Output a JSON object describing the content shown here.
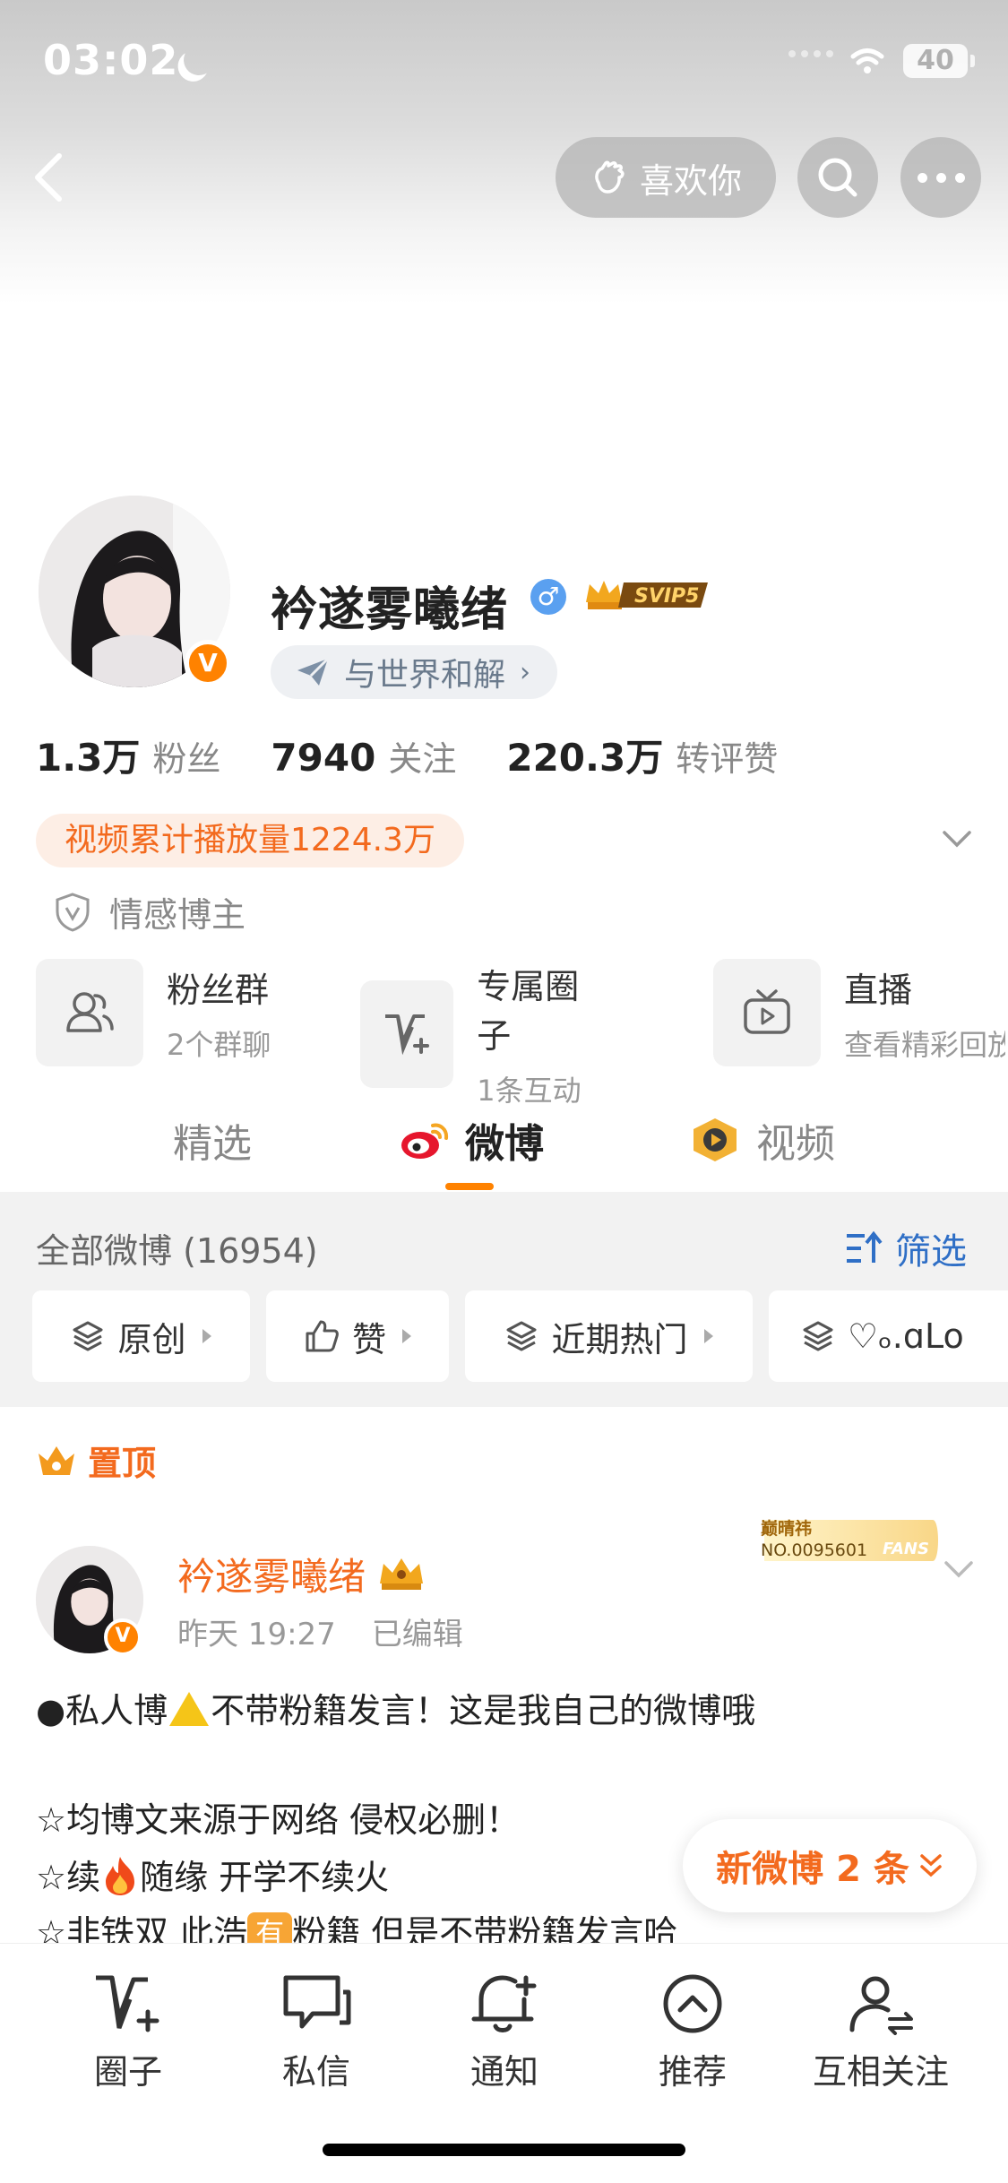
{
  "status_bar": {
    "time": "03:02",
    "battery": "40"
  },
  "top_nav": {
    "like_label": "喜欢你"
  },
  "profile": {
    "name": "衿遂雾曦绪",
    "gender_symbol": "♂",
    "vip_label": "SVIP5",
    "verified_mark": "V",
    "motto": "与世界和解",
    "stats": [
      {
        "num": "1.3万",
        "label": "粉丝"
      },
      {
        "num": "7940",
        "label": "关注"
      },
      {
        "num": "220.3万",
        "label": "转评赞"
      }
    ],
    "video_tag": "视频累计播放量1224.3万",
    "cert_label": "情感博主"
  },
  "features": [
    {
      "title": "粉丝群",
      "sub": "2个群聊",
      "icon": "group-icon"
    },
    {
      "title": "专属圈子",
      "sub": "1条互动",
      "icon": "circle-v-icon"
    },
    {
      "title": "直播",
      "sub": "查看精彩回放",
      "icon": "tv-icon"
    }
  ],
  "tabs": [
    {
      "label": "精选"
    },
    {
      "label": "微博"
    },
    {
      "label": "视频"
    }
  ],
  "feed_filter": {
    "all_count": "全部微博 (16954)",
    "filter_label": "筛选",
    "chips": [
      {
        "label": "原创"
      },
      {
        "label": "赞"
      },
      {
        "label": "近期热门"
      },
      {
        "label": "♡ₒ.ɑLo"
      }
    ]
  },
  "post": {
    "pinned_label": "置顶",
    "author": "衿遂雾曦绪",
    "time": "昨天 19:27",
    "edited": "已编辑",
    "fans_badge_name": "巅晴祎",
    "fans_badge_no": "NO.0095601",
    "fans_badge_word": "FANS",
    "line1_a": "●私人博",
    "line1_b": "不带粉籍发言！这是我自己的微博哦",
    "line2": "☆均博文来源于网络 侵权必删！",
    "line3_a": "☆续",
    "line3_b": "随缘 开学不续火",
    "line4_a": "☆非铁双 此浩",
    "line4_emoji": "有",
    "line4_b": "粉籍 但是不带粉籍发言哈"
  },
  "new_posts_label": "新微博 2 条",
  "bottom_nav": [
    {
      "label": "圈子",
      "icon": "circle-v-icon"
    },
    {
      "label": "私信",
      "icon": "chat-icon"
    },
    {
      "label": "通知",
      "icon": "bell-icon"
    },
    {
      "label": "推荐",
      "icon": "chevron-up-circle-icon"
    },
    {
      "label": "互相关注",
      "icon": "mutual-follow-icon"
    }
  ],
  "colors": {
    "accent": "#ff8200",
    "link": "#2f6fc6",
    "orange_text": "#f36a1e"
  }
}
